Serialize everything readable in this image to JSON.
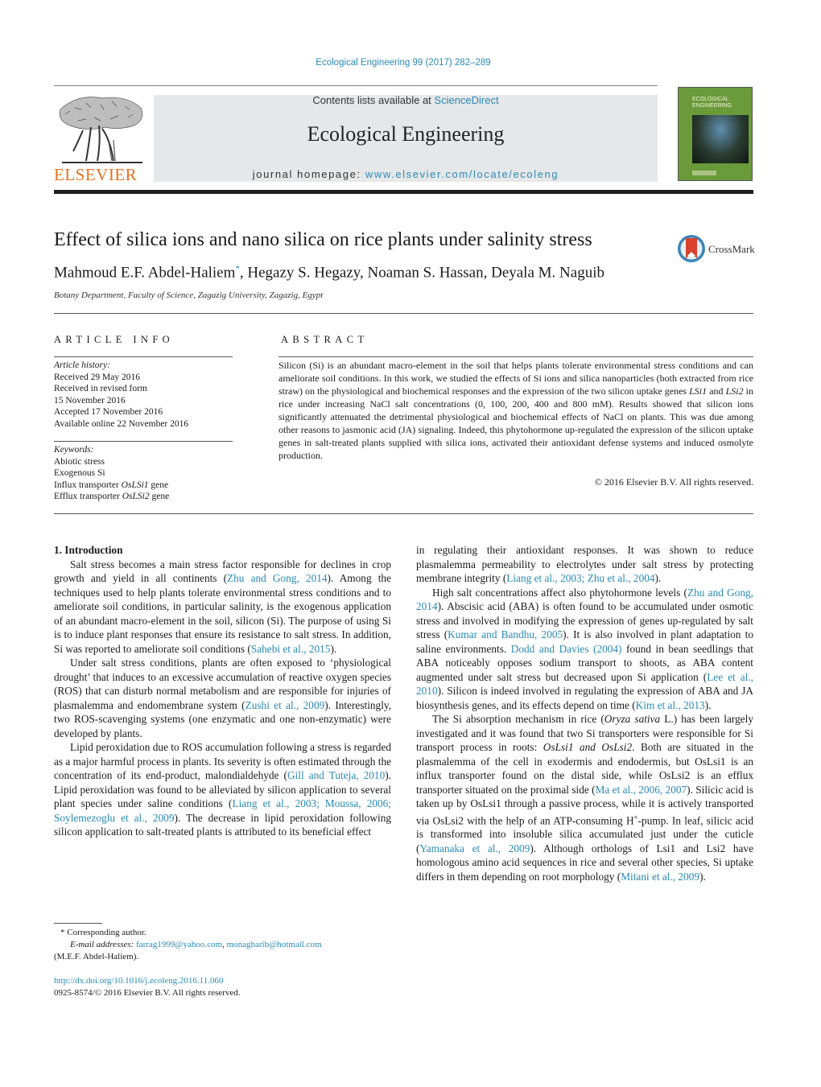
{
  "header": {
    "citation": "Ecological Engineering 99 (2017) 282–289",
    "contents_prefix": "Contents lists available at ",
    "contents_link": "ScienceDirect",
    "journal_name": "Ecological Engineering",
    "homepage_prefix": "journal homepage: ",
    "homepage_link": "www.elsevier.com/locate/ecoleng",
    "publisher_logo_text": "ELSEVIER",
    "cover_title": "ECOLOGICAL ENGINEERING",
    "crossmark_label": "CrossMark"
  },
  "colors": {
    "link": "#2a8ab5",
    "elsevier_orange": "#e9711c",
    "banner_gray": "#e6e7e8",
    "cover_green": "#6a9a3a",
    "crossmark_red": "#d9412e",
    "crossmark_ring": "#3a86b8"
  },
  "article": {
    "title": "Effect of silica ions and nano silica on rice plants under salinity stress",
    "authors": [
      {
        "name": "Mahmoud E.F. Abdel-Haliem",
        "mark": "*"
      },
      {
        "name": "Hegazy S. Hegazy"
      },
      {
        "name": "Noaman S. Hassan"
      },
      {
        "name": "Deyala M. Naguib"
      }
    ],
    "affiliation": "Botany Department, Faculty of Science, Zagazig University, Zagazig, Egypt"
  },
  "article_info": {
    "heading": "ARTICLE INFO",
    "history_label": "Article history:",
    "history": [
      "Received 29 May 2016",
      "Received in revised form",
      "15 November 2016",
      "Accepted 17 November 2016",
      "Available online 22 November 2016"
    ],
    "keywords_label": "Keywords:",
    "keywords": [
      {
        "pre": "Abiotic stress",
        "it": "",
        "post": ""
      },
      {
        "pre": "Exogenous Si",
        "it": "",
        "post": ""
      },
      {
        "pre": "Influx transporter ",
        "it": "OsLSi1",
        "post": " gene"
      },
      {
        "pre": "Efflux transporter ",
        "it": "OsLSi2",
        "post": " gene"
      }
    ]
  },
  "abstract": {
    "heading": "ABSTRACT",
    "parts": [
      {
        "t": "Silicon (Si) is an abundant macro-element in the soil that helps plants tolerate environmental stress conditions and can ameliorate soil conditions. In this work, we studied the effects of Si ions and silica nanoparticles (both extracted from rice straw) on the physiological and biochemical responses and the expression of the two silicon uptake genes "
      },
      {
        "t": "LSi1",
        "it": true
      },
      {
        "t": " and "
      },
      {
        "t": "LSi2",
        "it": true
      },
      {
        "t": " in rice under increasing NaCl salt concentrations (0, 100, 200, 400 and 800 mM). Results showed that silicon ions significantly attenuated the detrimental physiological and biochemical effects of NaCl on plants. This was due among other reasons to jasmonic acid (JA) signaling. Indeed, this phytohormone up-regulated the expression of the silicon uptake genes in salt-treated plants supplied with silica ions, activated their antioxidant defense systems and induced osmolyte production."
      }
    ],
    "copyright": "© 2016 Elsevier B.V. All rights reserved."
  },
  "body": {
    "section_heading": "1.  Introduction",
    "left_paragraphs": [
      [
        {
          "t": "Salt stress becomes a main stress factor responsible for declines in crop growth and yield in all continents ("
        },
        {
          "t": "Zhu and Gong, 2014",
          "link": true
        },
        {
          "t": "). Among the techniques used to help plants tolerate environmental stress conditions and to ameliorate soil conditions, in particular salinity, is the exogenous application of an abundant macro-element in the soil, silicon (Si). The purpose of using Si is to induce plant responses that ensure its resistance to salt stress. In addition, Si was reported to ameliorate soil conditions ("
        },
        {
          "t": "Sahebi et al., 2015",
          "link": true
        },
        {
          "t": ")."
        }
      ],
      [
        {
          "t": "Under salt stress conditions, plants are often exposed to ‘physiological drought’ that induces to an excessive accumulation of reactive oxygen species (ROS) that can disturb normal metabolism and are responsible for injuries of plasmalemma and endomembrane system ("
        },
        {
          "t": "Zushi et al., 2009",
          "link": true
        },
        {
          "t": "). Interestingly, two ROS-scavenging systems (one enzymatic and one non-enzymatic) were developed by plants."
        }
      ],
      [
        {
          "t": "Lipid peroxidation due to ROS accumulation following a stress is regarded as a major harmful process in plants. Its severity is often estimated through the concentration of its end-product, malondialdehyde ("
        },
        {
          "t": "Gill and Tuteja, 2010",
          "link": true
        },
        {
          "t": "). Lipid peroxidation was found to be alleviated by silicon application to several plant species under saline conditions ("
        },
        {
          "t": "Liang et al., 2003; Moussa, 2006; Soylemezoglu et al., 2009",
          "link": true
        },
        {
          "t": "). The decrease in lipid peroxidation following silicon application to salt-treated plants is attributed to its beneficial effect"
        }
      ]
    ],
    "right_paragraphs": [
      [
        {
          "t": "in regulating their antioxidant responses. It was shown to reduce plasmalemma permeability to electrolytes under salt stress by protecting membrane integrity ("
        },
        {
          "t": "Liang et al., 2003; Zhu et al., 2004",
          "link": true
        },
        {
          "t": ")."
        }
      ],
      [
        {
          "t": "High salt concentrations affect also phytohormone levels ("
        },
        {
          "t": "Zhu and Gong, 2014",
          "link": true
        },
        {
          "t": "). Abscisic acid (ABA) is often found to be accumulated under osmotic stress and involved in modifying the expression of genes up-regulated by salt stress ("
        },
        {
          "t": "Kumar and Bandhu, 2005",
          "link": true
        },
        {
          "t": "). It is also involved in plant adaptation to saline environments. "
        },
        {
          "t": "Dodd and Davies (2004)",
          "link": true
        },
        {
          "t": " found in bean seedlings that ABA noticeably opposes sodium transport to shoots, as ABA content augmented under salt stress but decreased upon Si application ("
        },
        {
          "t": "Lee et al., 2010",
          "link": true
        },
        {
          "t": "). Silicon is indeed involved in regulating the expression of ABA and JA biosynthesis genes, and its effects depend on time ("
        },
        {
          "t": "Kim et al., 2013",
          "link": true
        },
        {
          "t": ")."
        }
      ],
      [
        {
          "t": "The Si absorption mechanism in rice ("
        },
        {
          "t": "Oryza sativa",
          "it": true
        },
        {
          "t": " L.) has been largely investigated and it was found that two Si transporters were responsible for Si transport process in roots: "
        },
        {
          "t": "OsLsi1 and OsLsi2",
          "it": true
        },
        {
          "t": ". Both are situated in the plasmalemma of the cell in exodermis and endodermis, but OsLsi1 is an influx transporter found on the distal side, while OsLsi2 is an efflux transporter situated on the proximal side ("
        },
        {
          "t": "Ma et al., 2006, 2007",
          "link": true
        },
        {
          "t": "). Silicic acid is taken up by OsLsi1 through a passive process, while it is actively transported via OsLsi2 with the help of an ATP-consuming H"
        },
        {
          "t": "+",
          "sup": true
        },
        {
          "t": "-pump. In leaf, silicic acid is transformed into insoluble silica accumulated just under the cuticle ("
        },
        {
          "t": "Yamanaka et al., 2009",
          "link": true
        },
        {
          "t": "). Although orthologs of Lsi1 and Lsi2 have homologous amino acid sequences in rice and several other species, Si uptake differs in them depending on root morphology ("
        },
        {
          "t": "Mitani et al., 2009",
          "link": true
        },
        {
          "t": ")."
        }
      ]
    ]
  },
  "footnotes": {
    "corresponding": "*  Corresponding author.",
    "email_label": "E-mail addresses: ",
    "emails": [
      "farrag1999@yahoo.com",
      "monagharib@hotmail.com"
    ],
    "email_owner": "(M.E.F. Abdel-Haliem).",
    "doi": "http://dx.doi.org/10.1016/j.ecoleng.2016.11.060",
    "issn_copyright": "0925-8574/© 2016 Elsevier B.V. All rights reserved."
  }
}
